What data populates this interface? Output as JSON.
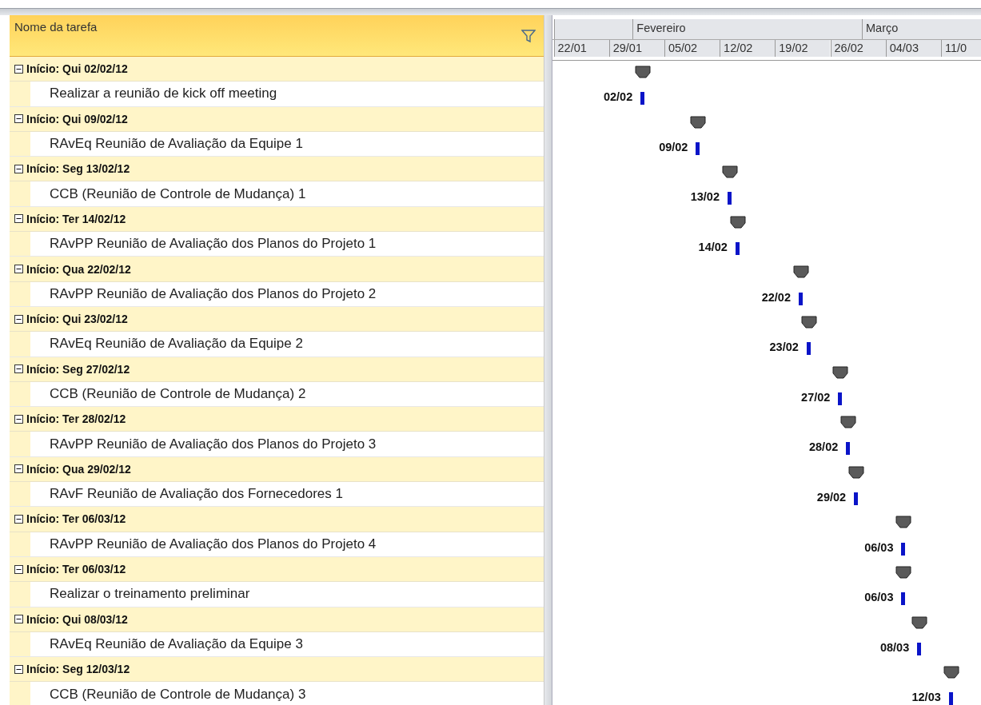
{
  "table": {
    "column_header": "Nome da tarefa",
    "groups": [
      {
        "title": "Início: Qui 02/02/12",
        "expanded": true,
        "task": {
          "name": "Realizar a reunião de kick off meeting",
          "date": "02/02"
        }
      },
      {
        "title": "Início: Qui 09/02/12",
        "expanded": true,
        "task": {
          "name": "RAvEq Reunião de Avaliação da Equipe 1",
          "date": "09/02"
        }
      },
      {
        "title": "Início: Seg 13/02/12",
        "expanded": true,
        "task": {
          "name": "CCB (Reunião de Controle de Mudança) 1",
          "date": "13/02"
        }
      },
      {
        "title": "Início: Ter 14/02/12",
        "expanded": true,
        "task": {
          "name": "RAvPP Reunião de Avaliação dos Planos do Projeto 1",
          "date": "14/02"
        }
      },
      {
        "title": "Início: Qua 22/02/12",
        "expanded": true,
        "task": {
          "name": "RAvPP Reunião de Avaliação dos Planos do Projeto 2",
          "date": "22/02"
        }
      },
      {
        "title": "Início: Qui 23/02/12",
        "expanded": true,
        "task": {
          "name": "RAvEq Reunião de Avaliação da Equipe 2",
          "date": "23/02"
        }
      },
      {
        "title": "Início: Seg 27/02/12",
        "expanded": true,
        "task": {
          "name": "CCB (Reunião de Controle de Mudança) 2",
          "date": "27/02"
        }
      },
      {
        "title": "Início: Ter 28/02/12",
        "expanded": true,
        "task": {
          "name": "RAvPP Reunião de Avaliação dos Planos do Projeto 3",
          "date": "28/02"
        }
      },
      {
        "title": "Início: Qua 29/02/12",
        "expanded": true,
        "task": {
          "name": "RAvF Reunião de Avaliação dos Fornecedores 1",
          "date": "29/02"
        }
      },
      {
        "title": "Início: Ter 06/03/12",
        "expanded": true,
        "task": {
          "name": "RAvPP Reunião de Avaliação dos Planos do Projeto 4",
          "date": "06/03"
        }
      },
      {
        "title": "Início: Ter 06/03/12",
        "expanded": true,
        "task": {
          "name": "Realizar o treinamento preliminar",
          "date": "06/03"
        }
      },
      {
        "title": "Início: Qui 08/03/12",
        "expanded": true,
        "task": {
          "name": "RAvEq Reunião de Avaliação da Equipe 3",
          "date": "08/03"
        }
      },
      {
        "title": "Início: Seg 12/03/12",
        "expanded": true,
        "task": {
          "name": "CCB (Reunião de Controle de Mudança) 3",
          "date": "12/03"
        }
      }
    ]
  },
  "timescale": {
    "months": [
      "Fevereiro",
      "Março"
    ],
    "weeks": [
      "22/01",
      "29/01",
      "05/02",
      "12/02",
      "19/02",
      "26/02",
      "04/03",
      "11/0"
    ]
  }
}
